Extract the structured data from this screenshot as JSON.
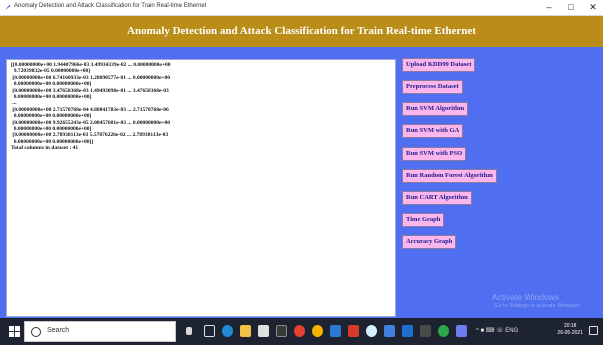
{
  "window": {
    "title": "Anomaly Detection and Attack Classification for Train Real-time Ethernet",
    "minimize_glyph": "–",
    "maximize_glyph": "□",
    "close_glyph": "✕"
  },
  "header": {
    "title": "Anomaly Detection and Attack Classification for Train Real-time Ethernet"
  },
  "output": {
    "lines": [
      "[[0.00000000e+00 1.94407966e-03 3.49934339e-02 ... 0.00000000e+00",
      "  9.72039832e-05 0.00000000e+00]",
      " [0.00000000e+00 6.74160933e-03 1.28090577e-01 ... 0.00000000e+00",
      "  0.00000000e+00 0.00000000e+00]",
      " [0.00000000e+00 3.47658368e-03 1.49493098e-01 ... 3.47658368e-03",
      "  0.00000000e+00 0.00000000e+00]",
      " ...",
      " [0.00000000e+00 2.71578768e-04 4.88841783e-03 ... 2.71578768e-06",
      "  0.00000000e+00 0.00000000e+00]",
      " [0.00000000e+00 9.92655243e-05 2.08457601e-03 ... 0.00000000e+00",
      "  0.00000000e+00 0.00000000e+00]",
      " [0.00000000e+00 2.78938113e-03 5.57876226e-02 ... 2.78938113e-03",
      "  0.00000000e+00 0.00000000e+00]]",
      "",
      "Total columns in dataset : 41"
    ]
  },
  "buttons": [
    {
      "label": "Upload KDD99 Dataset"
    },
    {
      "label": "Preprocess Dataset"
    },
    {
      "label": "Run SVM Algorithm"
    },
    {
      "label": "Run SVM with GA"
    },
    {
      "label": "Run SVM with PSO"
    },
    {
      "label": "Run Random Forest Algorithm"
    },
    {
      "label": "Run CART Algorithm"
    },
    {
      "label": "Time Graph"
    },
    {
      "label": "Accuracy Graph"
    }
  ],
  "watermark": {
    "line1": "Activate Windows",
    "line2": "Go to Settings to activate Windows."
  },
  "taskbar": {
    "search_placeholder": "Search",
    "tray_text": "^ ■ ⌨ ☏ ENG",
    "time": "20:18",
    "date": "26-05-2021"
  },
  "colors": {
    "background": "#4f6ff0",
    "header": "#b98d18",
    "button_bg": "#fbb6ee",
    "button_text": "#1b1b8a"
  }
}
